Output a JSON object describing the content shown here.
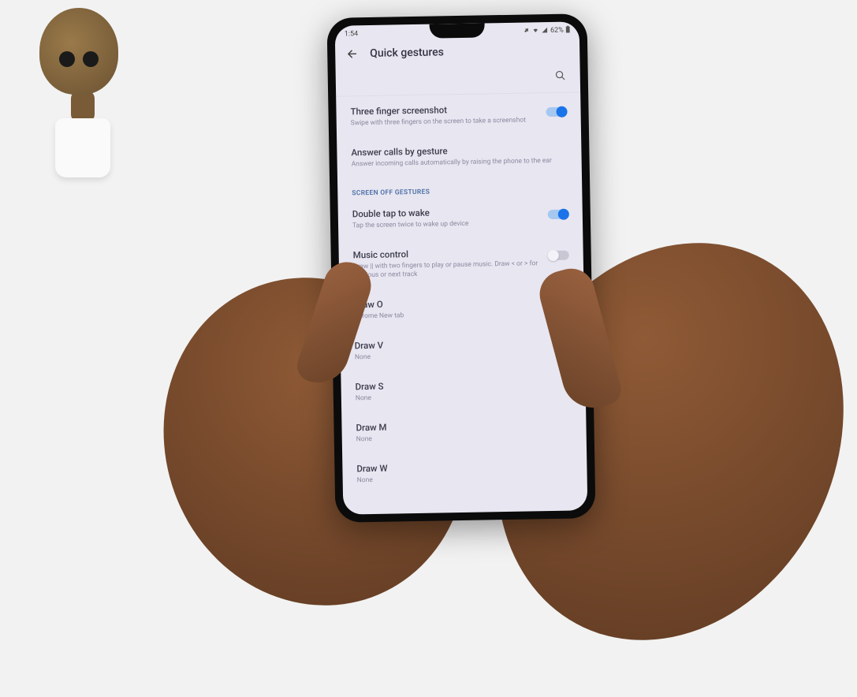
{
  "status_bar": {
    "time": "1:54",
    "battery_text": "62%"
  },
  "header": {
    "title": "Quick gestures"
  },
  "items": [
    {
      "title": "Three finger screenshot",
      "desc": "Swipe with three fingers on the screen to take a screenshot",
      "toggle": "on"
    },
    {
      "title": "Answer calls by gesture",
      "desc": "Answer incoming calls automatically by raising the phone to the ear",
      "toggle": null
    }
  ],
  "section_header": "SCREEN OFF GESTURES",
  "items2": [
    {
      "title": "Double tap to wake",
      "desc": "Tap the screen twice to wake up device",
      "toggle": "on"
    },
    {
      "title": "Music control",
      "desc": "Draw || with two fingers to play or pause music. Draw < or > for previous or next track",
      "toggle": "off"
    },
    {
      "title": "Draw O",
      "desc": "Chrome New tab",
      "toggle": null
    },
    {
      "title": "Draw V",
      "desc": "None",
      "toggle": null
    },
    {
      "title": "Draw S",
      "desc": "None",
      "toggle": null
    },
    {
      "title": "Draw M",
      "desc": "None",
      "toggle": null
    },
    {
      "title": "Draw W",
      "desc": "None",
      "toggle": null
    }
  ]
}
